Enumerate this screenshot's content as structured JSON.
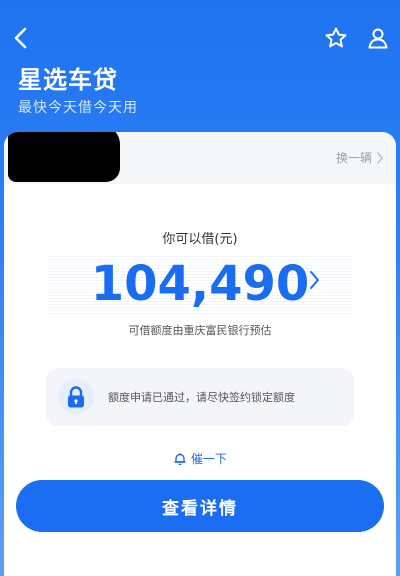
{
  "header": {
    "title": "星选车贷",
    "subtitle": "最快今天借今天用"
  },
  "icons": {
    "back": "back-arrow-icon",
    "favorite": "star-outline-icon",
    "profile": "user-outline-icon",
    "lock": "lock-icon",
    "bell": "bell-icon"
  },
  "car": {
    "switch_label": "换一辆"
  },
  "loan": {
    "label": "你可以借(元)",
    "amount": "104,490",
    "estimate_note": "可借额度由重庆富民银行预估"
  },
  "notice": {
    "text": "额度申请已通过，请尽快签约锁定额度"
  },
  "remind": {
    "label": "催一下"
  },
  "cta": {
    "label": "查看详情"
  },
  "colors": {
    "brand_blue": "#1b6ef1",
    "amount_blue": "#1a6cf0",
    "header_gradient_top": "#1f73f0"
  }
}
